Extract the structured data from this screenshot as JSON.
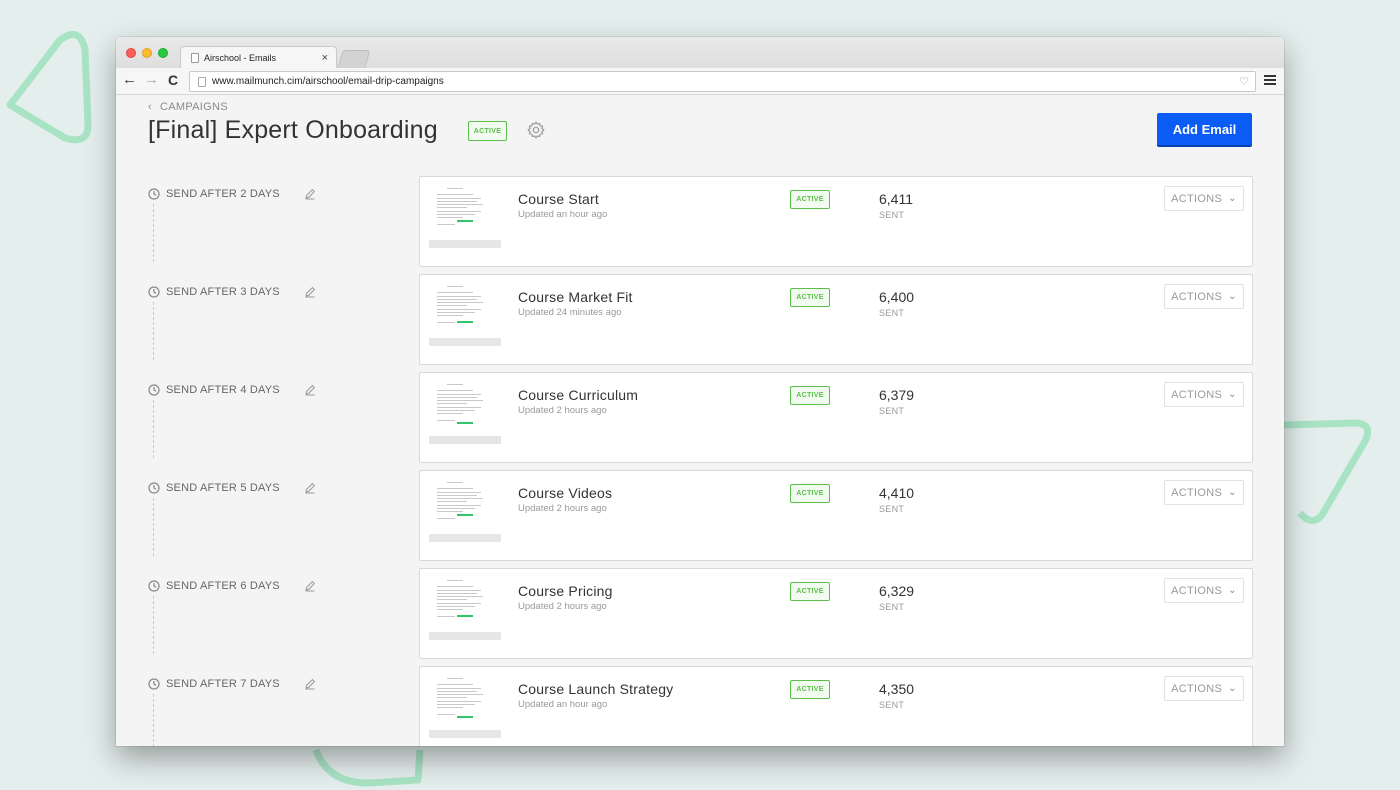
{
  "browser": {
    "tab_title": "Airschool - Emails",
    "tab_close": "×",
    "url": "www.mailmunch.cim/airschool/email-drip-campaigns"
  },
  "campaign": {
    "breadcrumb": "CAMPAIGNS",
    "title": "[Final] Expert Onboarding",
    "status": "ACTIVE",
    "add_email_label": "Add Email"
  },
  "colors": {
    "accent_blue": "#0a5cf5",
    "active_green": "#5cbf4a"
  },
  "emails": [
    {
      "delay": "SEND AFTER 2 DAYS",
      "name": "Course Start",
      "updated": "Updated an hour ago",
      "status": "ACTIVE",
      "sent": "6,411",
      "sent_label": "SENT",
      "actions": "ACTIONS"
    },
    {
      "delay": "SEND AFTER 3 DAYS",
      "name": "Course Market Fit",
      "updated": "Updated 24 minutes ago",
      "status": "ACTIVE",
      "sent": "6,400",
      "sent_label": "SENT",
      "actions": "ACTIONS"
    },
    {
      "delay": "SEND AFTER 4 DAYS",
      "name": "Course Curriculum",
      "updated": "Updated 2 hours ago",
      "status": "ACTIVE",
      "sent": "6,379",
      "sent_label": "SENT",
      "actions": "ACTIONS"
    },
    {
      "delay": "SEND AFTER 5 DAYS",
      "name": "Course Videos",
      "updated": "Updated 2 hours ago",
      "status": "ACTIVE",
      "sent": "4,410",
      "sent_label": "SENT",
      "actions": "ACTIONS"
    },
    {
      "delay": "SEND AFTER 6 DAYS",
      "name": "Course Pricing",
      "updated": "Updated 2 hours ago",
      "status": "ACTIVE",
      "sent": "6,329",
      "sent_label": "SENT",
      "actions": "ACTIONS"
    },
    {
      "delay": "SEND AFTER 7 DAYS",
      "name": "Course Launch Strategy",
      "updated": "Updated an hour ago",
      "status": "ACTIVE",
      "sent": "4,350",
      "sent_label": "SENT",
      "actions": "ACTIONS"
    }
  ]
}
